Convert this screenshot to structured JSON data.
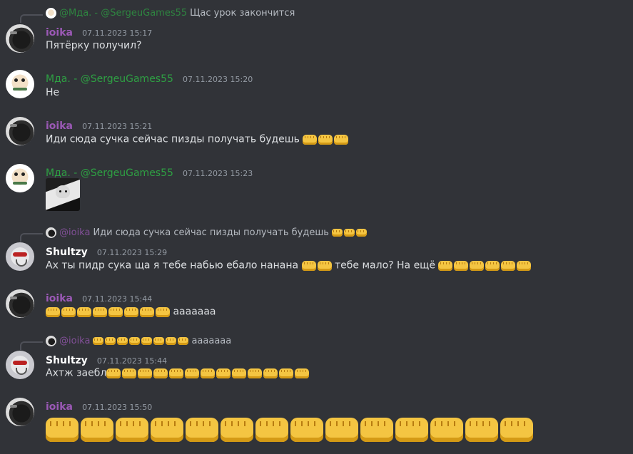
{
  "messages": [
    {
      "reply": {
        "name": "@Мда. - @SergeuGames55",
        "text": "Щас урок закончится"
      },
      "author": "ioika",
      "time": "07.11.2023 15:17",
      "text": "Пятёрку получил?"
    },
    {
      "author": "Мда. - @SergeuGames55",
      "time": "07.11.2023 15:20",
      "text": "Не"
    },
    {
      "author": "ioika",
      "time": "07.11.2023 15:21",
      "text": "Иди сюда сучка сейчас пизды получать будешь",
      "emoji_name": "fist-emoji",
      "emoji_count": 3
    },
    {
      "author": "Мда. - @SergeuGames55",
      "time": "07.11.2023 15:23",
      "attachment": "dog-image"
    },
    {
      "reply": {
        "name": "@ioika",
        "text": "Иди сюда сучка сейчас пизды получать будешь",
        "emoji_count": 3
      },
      "author": "Shultzy",
      "time": "07.11.2023 15:29",
      "text_a": "Ах ты пидр сука ща я тебе набью ебало нанана",
      "emoji_a_count": 2,
      "text_b": "тебе мало? На ещё",
      "emoji_b_count": 6
    },
    {
      "author": "ioika",
      "time": "07.11.2023 15:44",
      "emoji_count": 8,
      "text": "ааааааа"
    },
    {
      "reply": {
        "name": "@ioika",
        "text": "ааааааа",
        "emoji_count": 8
      },
      "author": "Shultzy",
      "time": "07.11.2023 15:44",
      "text": "Ахтж заебл",
      "emoji_count": 13
    },
    {
      "author": "ioika",
      "time": "07.11.2023 15:50",
      "emoji_count": 14
    }
  ],
  "colors": {
    "background": "#313338",
    "ioika": "#9b59b6",
    "mda": "#2ea043",
    "shultzy": "#ffffff",
    "timestamp": "#949ba4"
  }
}
